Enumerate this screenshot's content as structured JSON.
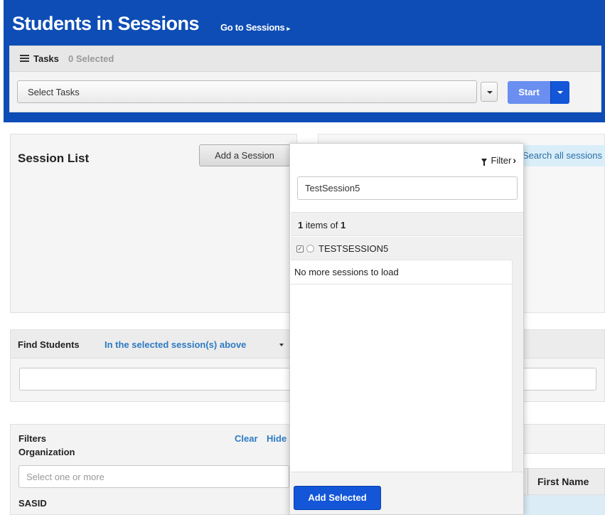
{
  "header": {
    "title": "Students in Sessions",
    "goto_label": "Go to Sessions",
    "goto_arrow": "▸"
  },
  "tasks": {
    "label": "Tasks",
    "count": "0 Selected",
    "select_value": "Select Tasks",
    "start_label": "Start"
  },
  "session_list": {
    "title": "Session List",
    "add_button": "Add a Session",
    "search_all_text": "Search all sessions"
  },
  "popover": {
    "filter_label": "Filter",
    "filter_chevron": "›",
    "search_value": "TestSession5",
    "items_prefix": "1",
    "items_middle": " items of ",
    "items_total": "1",
    "sessions": [
      {
        "name": "TESTSESSION5",
        "checked": true
      }
    ],
    "check_mark": "✓",
    "no_more": "No more sessions to load",
    "add_selected": "Add Selected"
  },
  "find_students": {
    "label": "Find Students",
    "scope": "In the selected session(s) above"
  },
  "filters": {
    "label": "Filters",
    "clear": "Clear",
    "hide": "Hide",
    "organization_label": "Organization",
    "organization_placeholder": "Select one or more",
    "sasid_label": "SASID"
  },
  "table": {
    "first_name_header": "First Name"
  },
  "colors": {
    "header_blue": "#0d4db5",
    "primary_button": "#1356d8",
    "link_blue": "#2d7ac2"
  }
}
